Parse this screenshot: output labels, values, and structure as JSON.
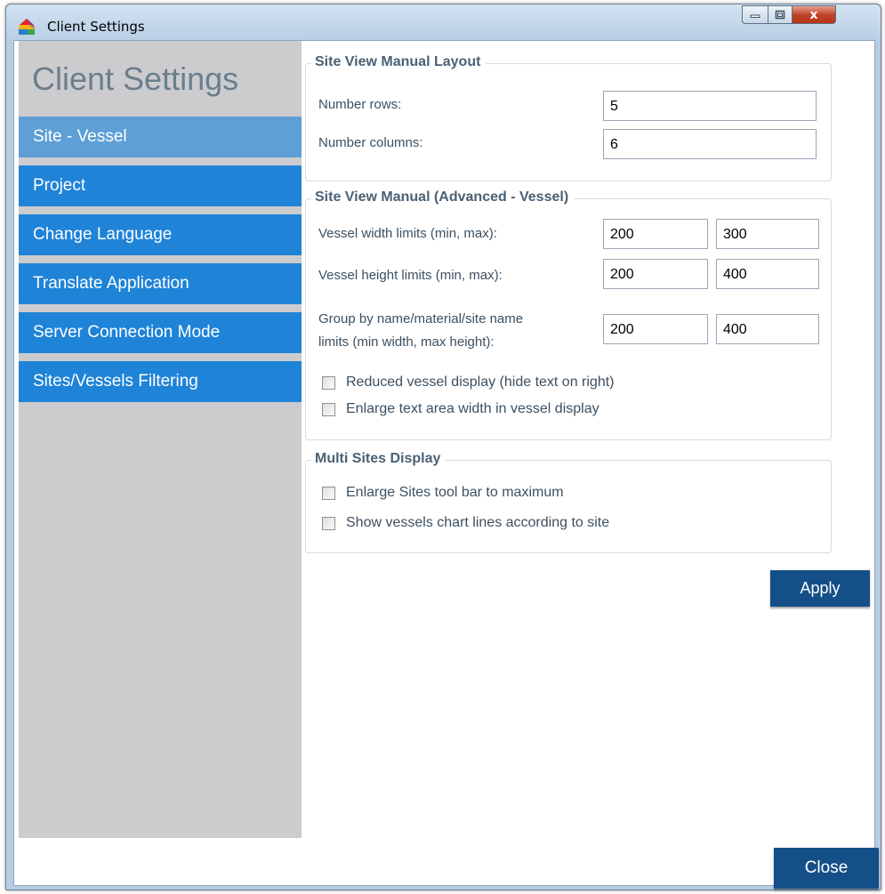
{
  "window": {
    "title": "Client Settings",
    "controls": {
      "minimize": "minimize",
      "maximize": "maximize",
      "close": "x"
    }
  },
  "sidebar": {
    "title": "Client Settings",
    "items": [
      {
        "label": "Site - Vessel",
        "active": true
      },
      {
        "label": "Project"
      },
      {
        "label": "Change Language"
      },
      {
        "label": "Translate Application"
      },
      {
        "label": "Server Connection Mode"
      },
      {
        "label": "Sites/Vessels Filtering"
      }
    ]
  },
  "manual_layout": {
    "title": "Site View Manual Layout",
    "rows_label": "Number rows:",
    "rows_value": "5",
    "cols_label": "Number columns:",
    "cols_value": "6"
  },
  "advanced": {
    "title": "Site View Manual (Advanced - Vessel)",
    "width_label": "Vessel width limits (min, max):",
    "width_min": "200",
    "width_max": "300",
    "height_label": "Vessel height limits (min, max):",
    "height_min": "200",
    "height_max": "400",
    "group_label_line1": "Group by name/material/site name",
    "group_label_line2": "limits (min width, max height):",
    "group_min": "200",
    "group_max": "400",
    "reduced_display": "Reduced vessel display (hide text on right)",
    "enlarge_text": "Enlarge text area width in vessel display"
  },
  "multi_sites": {
    "title": "Multi Sites Display",
    "enlarge_toolbar": "Enlarge Sites tool bar to maximum",
    "show_chart_lines": "Show vessels chart lines according to site"
  },
  "buttons": {
    "apply": "Apply",
    "close": "Close"
  },
  "colors": {
    "nav_blue": "#1f83d8",
    "nav_active": "#5e9fd6",
    "button_navy": "#154f88",
    "sidebar_gray": "#cccccf"
  }
}
